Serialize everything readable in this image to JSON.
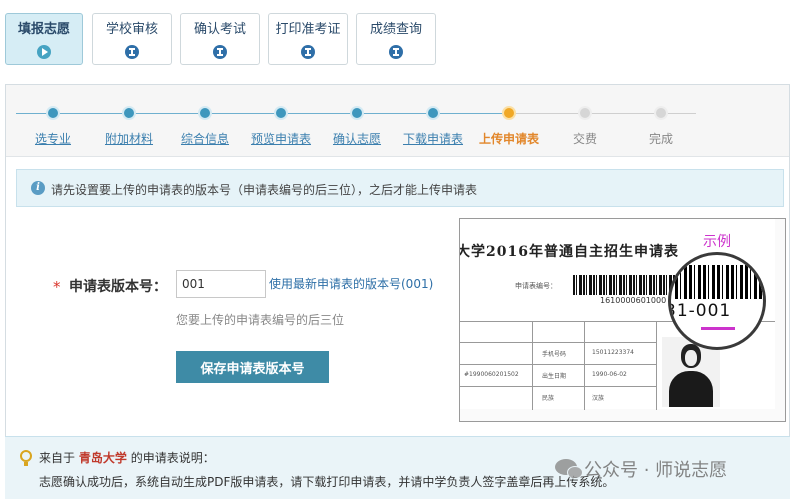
{
  "tabs": [
    {
      "label": "填报志愿",
      "icon": "play-icon",
      "active": true
    },
    {
      "label": "学校审核",
      "icon": "hourglass-icon",
      "active": false
    },
    {
      "label": "确认考试",
      "icon": "hourglass-icon",
      "active": false
    },
    {
      "label": "打印准考证",
      "icon": "hourglass-icon",
      "active": false
    },
    {
      "label": "成绩查询",
      "icon": "hourglass-icon",
      "active": false
    }
  ],
  "steps": [
    {
      "label": "选专业",
      "state": "done"
    },
    {
      "label": "附加材料",
      "state": "done"
    },
    {
      "label": "综合信息",
      "state": "done"
    },
    {
      "label": "预览申请表",
      "state": "done"
    },
    {
      "label": "确认志愿",
      "state": "done"
    },
    {
      "label": "下载申请表",
      "state": "done"
    },
    {
      "label": "上传申请表",
      "state": "current"
    },
    {
      "label": "交费",
      "state": "todo"
    },
    {
      "label": "完成",
      "state": "todo"
    }
  ],
  "info": {
    "icon": "info-icon",
    "text": "请先设置要上传的申请表的版本号（申请表编号的后三位），之后才能上传申请表"
  },
  "form": {
    "required_mark": "*",
    "label": "申请表版本号：",
    "value": "001",
    "latest_link": "使用最新申请表的版本号(001)",
    "hint": "您要上传的申请表编号的后三位",
    "save_button": "保存申请表版本号"
  },
  "example": {
    "label": "示例",
    "sheet_title": "大学2016年普通自主招生申请表",
    "sheet_field": "申请表编号：",
    "barcode_number": "1610000601000",
    "magnified_text": "31-001",
    "grid_cells": [
      "手机号码",
      "15011223374",
      "出生日期",
      "1990-06-02",
      "民族",
      "汉族",
      "#1990060201502"
    ]
  },
  "note": {
    "icon": "lightbulb-icon",
    "prefix": "来自于",
    "school": "青岛大学",
    "suffix": "的申请表说明：",
    "text": "志愿确认成功后，系统自动生成PDF版申请表，请下载打印申请表，并请中学负责人签字盖章后再上传系统。"
  },
  "watermark": "公众号 · 师说志愿",
  "colors": {
    "accent": "#3e8ba6",
    "step_done": "#3e97bd",
    "step_current": "#f0a826",
    "step_todo": "#d6d6d6",
    "required": "#d9342b",
    "example_label": "#cc33cc"
  }
}
